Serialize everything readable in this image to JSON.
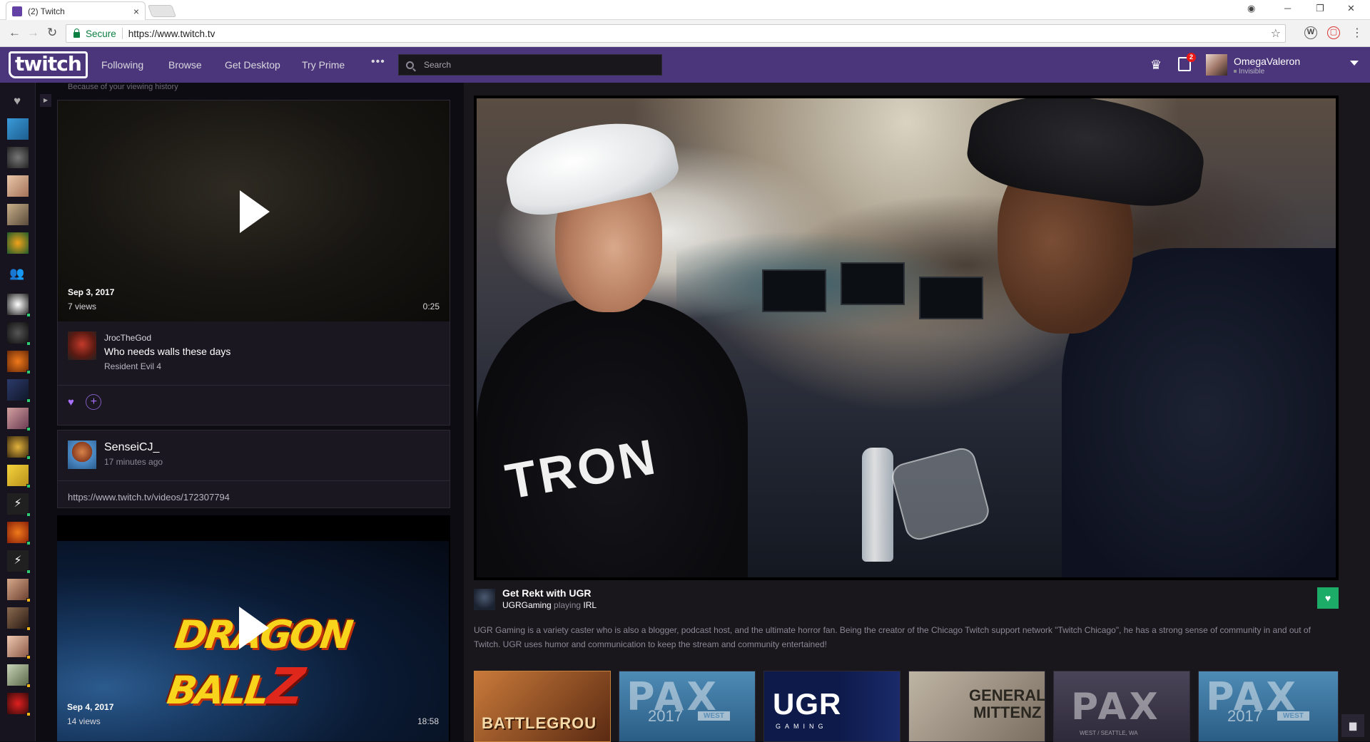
{
  "browser": {
    "tab_title": "(2) Twitch",
    "tab_close": "×",
    "secure_label": "Secure",
    "url": "https://www.twitch.tv"
  },
  "nav": {
    "logo": "twitch",
    "links": [
      "Following",
      "Browse",
      "Get Desktop",
      "Try Prime"
    ],
    "more": "•••",
    "search_placeholder": "Search",
    "notification_count": "2",
    "username": "OmegaValeron",
    "status": "Invisible"
  },
  "feed": {
    "hint": "Because of your viewing history",
    "video1": {
      "date": "Sep 3, 2017",
      "views": "7 views",
      "duration": "0:25",
      "channel": "JrocTheGod",
      "title": "Who needs walls these days",
      "game": "Resident Evil 4"
    },
    "post": {
      "author": "SenseiCJ_",
      "time": "17 minutes ago",
      "link": "https://www.twitch.tv/videos/172307794"
    },
    "video2": {
      "date": "Sep 4, 2017",
      "views": "14 views",
      "duration": "18:58",
      "art_text": "DRAGON BALL",
      "art_z": "Z"
    }
  },
  "stream": {
    "title": "Get Rekt with UGR",
    "channel": "UGRGaming",
    "playing_word": "playing",
    "game": "IRL",
    "tee_text": "TRON",
    "description": "UGR Gaming is a variety caster who is also a blogger, podcast host, and the ultimate horror fan. Being the creator of the Chicago Twitch support network \"Twitch Chicago\", he has a strong sense of community in and out of Twitch. UGR uses humor and communication to keep the stream and community entertained!"
  },
  "rail": [
    {
      "kind": "battlegrounds",
      "text": "BATTLEGROU"
    },
    {
      "kind": "pax",
      "big": "PAX",
      "year": "2017",
      "region": "WEST"
    },
    {
      "kind": "ugr",
      "big": "UGR",
      "sub": "GAMING"
    },
    {
      "kind": "mittenz",
      "big": "GENERAL\nMITTENZ"
    },
    {
      "kind": "pax",
      "big": "PAX",
      "year": "",
      "region": "WEST / SEATTLE, WA"
    },
    {
      "kind": "pax",
      "big": "PAX",
      "year": "2017",
      "region": "WEST"
    }
  ],
  "colors": {
    "brand": "#4b367c",
    "accent": "#a970ff",
    "follow": "#1cac67",
    "online": "#2ecc71",
    "idle": "#f2b51a"
  }
}
